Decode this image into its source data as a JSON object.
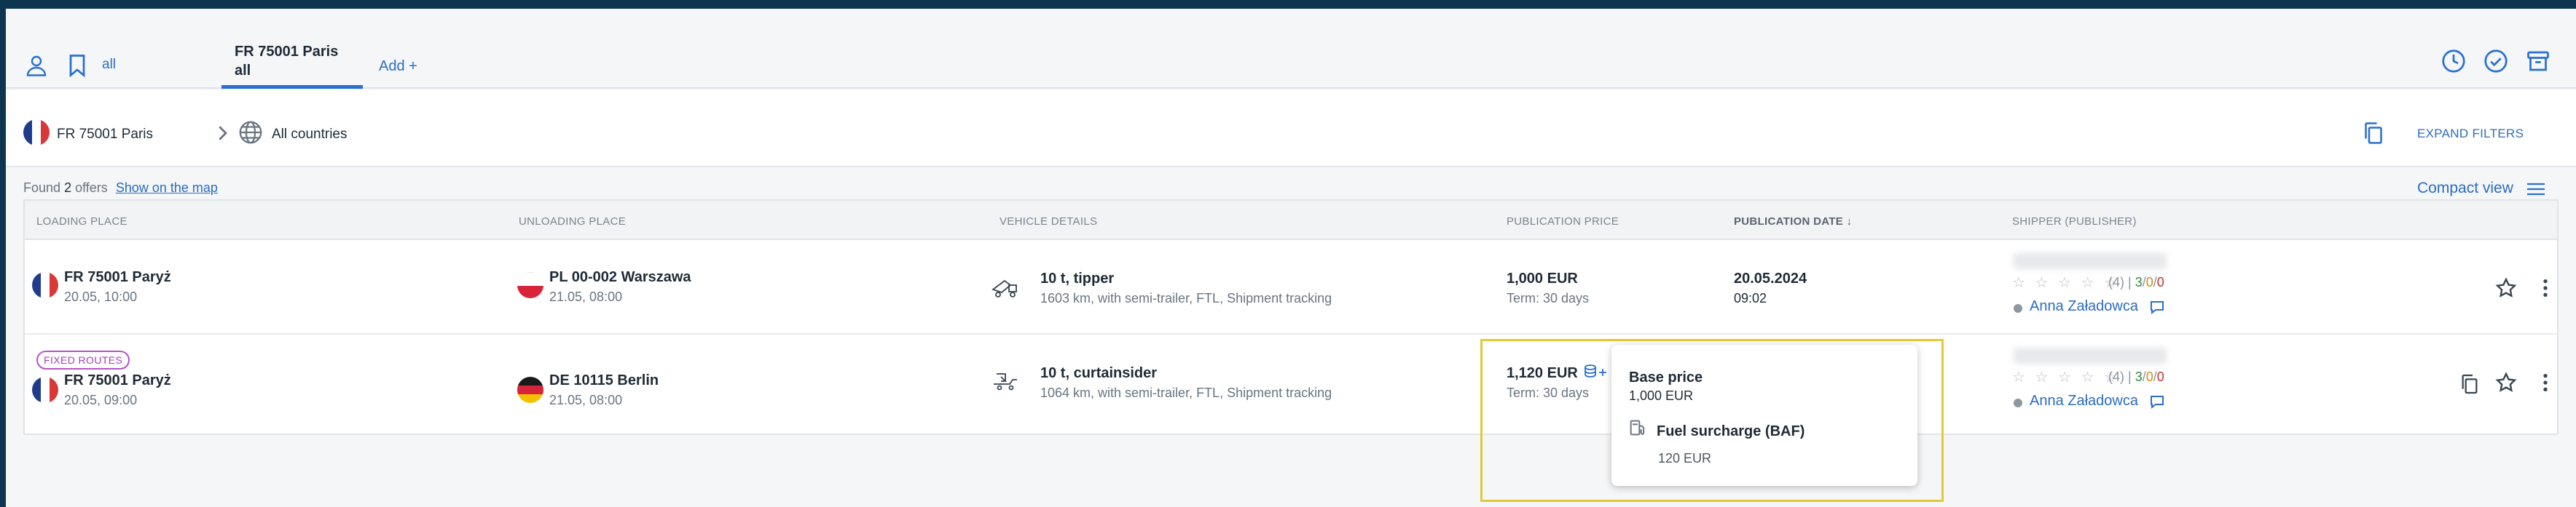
{
  "tabs": {
    "all_label": "all",
    "active_line1": "FR 75001 Paris",
    "active_line2": "all",
    "add_label": "Add +"
  },
  "filters": {
    "origin": "FR 75001 Paris",
    "destination": "All countries",
    "expand_label": "EXPAND FILTERS"
  },
  "results": {
    "found_prefix": "Found",
    "found_count": "2",
    "found_suffix": "offers",
    "show_map": "Show on the map",
    "compact_view": "Compact view"
  },
  "columns": {
    "loading": "LOADING PLACE",
    "unloading": "UNLOADING PLACE",
    "vehicle": "VEHICLE DETAILS",
    "price": "PUBLICATION PRICE",
    "date": "PUBLICATION DATE ↓",
    "shipper": "SHIPPER (PUBLISHER)"
  },
  "offers": [
    {
      "badge": "",
      "loading_place": "FR 75001 Paryż",
      "loading_time": "20.05, 10:00",
      "unloading_place": "PL 00-002 Warszawa",
      "unloading_time": "21.05, 08:00",
      "vehicle": "10 t, tipper",
      "vehicle_details": "1603 km, with semi-trailer, FTL, Shipment tracking",
      "price": "1,000 EUR",
      "term": "Term: 30 days",
      "pub_date": "20.05.2024",
      "pub_time": "09:02",
      "stars": "☆ ☆ ☆ ☆ ☆",
      "rating_count": "(4)",
      "rating_g": "3",
      "rating_o": "0",
      "rating_r": "0",
      "shipper_name": "Anna Załadowca"
    },
    {
      "badge": "FIXED ROUTES",
      "loading_place": "FR 75001 Paryż",
      "loading_time": "20.05, 09:00",
      "unloading_place": "DE 10115 Berlin",
      "unloading_time": "21.05, 08:00",
      "vehicle": "10 t, curtainsider",
      "vehicle_details": "1064 km, with semi-trailer, FTL, Shipment tracking",
      "price": "1,120 EUR",
      "term": "Term: 30 days",
      "stars": "☆ ☆ ☆ ☆ ☆",
      "rating_count": "(4)",
      "rating_g": "3",
      "rating_o": "0",
      "rating_r": "0",
      "shipper_name": "Anna Załadowca"
    }
  ],
  "tooltip": {
    "base_label": "Base price",
    "base_value": "1,000 EUR",
    "surcharge_label": "Fuel surcharge (BAF)",
    "surcharge_value": "120 EUR"
  },
  "colors": {
    "accent": "#2a6fd0",
    "link": "#2d6cc0",
    "badge": "#b454c9",
    "highlight": "#e3c83a"
  }
}
